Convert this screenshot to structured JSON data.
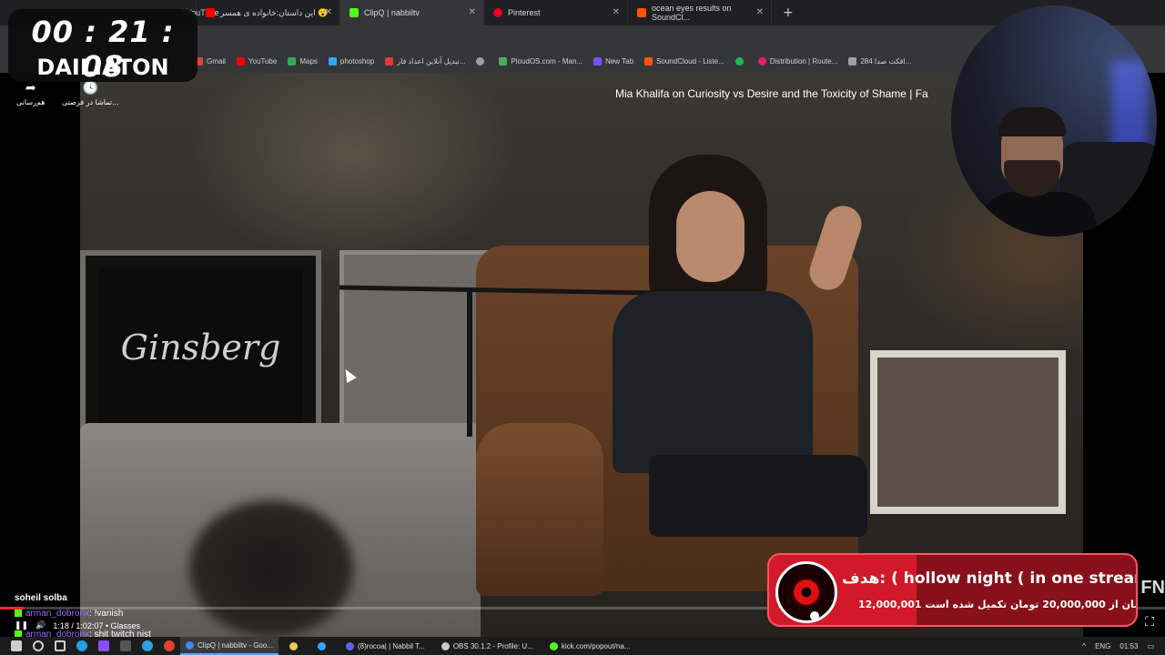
{
  "browser": {
    "tabs": [
      {
        "label": "YouTube",
        "favicon_color": "#ff0000",
        "active": false
      },
      {
        "label": "این داستان:خانواده ی همسر 😮",
        "favicon_color": "#ff0000",
        "active": false
      },
      {
        "label": "ClipQ | nabbiltv",
        "favicon_color": "#53fc18",
        "active": true
      },
      {
        "label": "Pinterest",
        "favicon_color": "#e60023",
        "active": false
      },
      {
        "label": "ocean eyes results on SoundCl...",
        "favicon_color": "#ff5500",
        "active": false
      }
    ],
    "bookmarks": [
      {
        "label": "Gmail",
        "icon_color": "#ea4335"
      },
      {
        "label": "YouTube",
        "icon_color": "#ff0000"
      },
      {
        "label": "Maps",
        "icon_color": "#34a853"
      },
      {
        "label": "photoshop",
        "icon_color": "#31a8ff"
      },
      {
        "label": "تبدیل آنلاین اعداد فار...",
        "icon_color": "#e53935"
      },
      {
        "label": "",
        "icon_color": "#9e9e9e"
      },
      {
        "label": "PloudOS.com - Man...",
        "icon_color": "#4caf50"
      },
      {
        "label": "New Tab",
        "icon_color": "#7b4dff"
      },
      {
        "label": "SoundCloud - Liste...",
        "icon_color": "#ff5500"
      },
      {
        "label": "",
        "icon_color": "#1db954"
      },
      {
        "label": "Distribution | Route...",
        "icon_color": "#e91e63"
      },
      {
        "label": "284 افکت صدا...",
        "icon_color": "#9e9e9e"
      }
    ]
  },
  "timer": {
    "clock": "00 : 21 : 08",
    "label": "DAILIATON"
  },
  "video": {
    "title": "Mia Khalifa on Curiosity vs Desire and the Toxicity of Shame | Fa",
    "controls": [
      {
        "label": "هم‌رسانی",
        "icon": "share-icon",
        "glyph": "➦"
      },
      {
        "label": "تماشا در فرصتی...",
        "icon": "clock-icon",
        "glyph": "🕓"
      }
    ],
    "painting_text": "Ginsberg",
    "fn_text": "FN",
    "progress_fraction": 0.02,
    "accent": "#ff2a2a"
  },
  "goal": {
    "headline": "هدف: ( hollow night ( in one stream",
    "sub": "12,000,001 تومان از 20,000,000 تومان تکمیل شده است."
  },
  "chat": {
    "streamer": "soheil solba",
    "messages": [
      {
        "user": "arman_dobronx",
        "text": ": !vanish"
      },
      {
        "user": "arman_dobronx",
        "text": ": shit twitch nist"
      }
    ],
    "player_time": "1:18 / 1:02:07 • Glasses"
  },
  "taskbar": {
    "apps": [
      {
        "label": "ClipQ | nabbiltv - Goo...",
        "color": "#4285f4",
        "active": true
      },
      {
        "label": "",
        "color": "#f2c94c",
        "active": false
      },
      {
        "label": "",
        "color": "#31a8ff",
        "active": false
      },
      {
        "label": "(8)rocoa| | Nabbil T...",
        "color": "#5865f2",
        "active": false
      },
      {
        "label": "OBS 30.1.2 - Profile: U...",
        "color": "#cccccc",
        "active": false
      },
      {
        "label": "kick.com/popout/na...",
        "color": "#53fc18",
        "active": false
      }
    ],
    "lang": "ENG",
    "time": "01:53"
  }
}
